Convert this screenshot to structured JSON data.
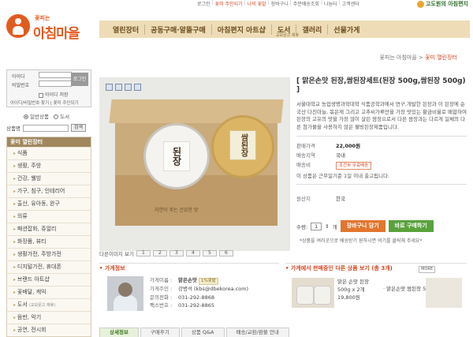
{
  "topbar": {
    "links": [
      "로그인",
      "꽃미 주인되기",
      "나의 꽃밭",
      "장바구니",
      "주문배송조회",
      "나눔터",
      "고객센터"
    ],
    "sponsor": "고도원의 아침편지"
  },
  "logo": {
    "small": "꽃피는",
    "big": "아침마을"
  },
  "nav": {
    "items": [
      {
        "label": "열린장터"
      },
      {
        "label": "공동구매·알뜰구매"
      },
      {
        "label": "아침편지 아트샵"
      },
      {
        "label": "도서",
        "sub": "교보문고 제휴"
      },
      {
        "label": "갤러리"
      },
      {
        "label": "선물가게"
      }
    ]
  },
  "breadcrumb": {
    "home": "꽃피는 아침마을",
    "sep": ">",
    "current": "꽃미 열린장터"
  },
  "login": {
    "id_label": "아이디",
    "pw_label": "비밀번호",
    "button": "로그인",
    "save_label": "아이디 저장",
    "links": "아이디/비밀번호 찾기 | 꽃미 주인되기"
  },
  "search": {
    "type_options": [
      "일반상품",
      "도서"
    ],
    "label": "상품명",
    "button": "검색"
  },
  "categories": {
    "title": "꽃미 열린장터",
    "items": [
      {
        "label": "식품"
      },
      {
        "label": "생활, 주방"
      },
      {
        "label": "건강, 웰빙"
      },
      {
        "label": "가구, 침구, 인테리어"
      },
      {
        "label": "출산, 유아동, 완구"
      },
      {
        "label": "의류"
      },
      {
        "label": "패션잡화, 쥬얼리"
      },
      {
        "label": "화장품, 뷰티"
      },
      {
        "label": "생활가전, 주방가전"
      },
      {
        "label": "디지털가전, 휴대폰"
      },
      {
        "label": "브랜드 아트샵"
      },
      {
        "label": "꽃배달, 케익"
      },
      {
        "label": "도서",
        "sub": "(교보문고 제휴)"
      },
      {
        "label": "음반, 악기"
      },
      {
        "label": "공연, 전시회"
      }
    ]
  },
  "product": {
    "jar_labels": [
      "된장",
      "쌈된장"
    ],
    "box_slogan": "자연이 주는 건강한 맛",
    "title": "[ 맑은손맛 된장,쌈된장세트(된장 500g,쌈된장 500g) ]",
    "description": "서울대학교 농업생명과학대학 식품공학과에서 연구,개발한 된장과 이 된장에 순국산 다진마늘, 볶은깨 그리고 고추씨가루만을 가장 맛있는 황금비율로 배합하여 된장의 고유의 맛을 가장 많이 살린 쌈장으로서 다른 쌈장과는 다르게 일체의 다른 첨가물을 사용하지 않은 웰빙된장제품입니다.",
    "price_label": "판매가격",
    "price": "22,000원",
    "region_label": "배송지역",
    "region": "국내",
    "shipping_label": "배송비",
    "shipping": "조건부 무료배송",
    "note": "이 상품은 근무일기준 1일 이내 출고됩니다.",
    "origin_label": "원산지",
    "origin": "한국",
    "qty_label": "수량:",
    "qty": "1",
    "qty_unit": "개",
    "cart_button": "장바구니 담기",
    "buy_button": "바로 구매하기",
    "buy_note": "*상품을 여러곳으로 배송받기 원하시면 여기를 클릭해 주세요*",
    "thumbs_label": "다른이미지 보기",
    "thumbs": [
      "1",
      "2",
      "3",
      "4",
      "5",
      "6"
    ]
  },
  "shop": {
    "title": "가게정보",
    "name_label": "가게이름 :",
    "name": "맑은손맛",
    "grade": "1%꽃밭",
    "owner_label": "가게주인 :",
    "owner": "강병석 (kbs@dbekorea.com)",
    "phone_label": "문의전화 :",
    "phone": "031-292-8868",
    "fax_label": "팩스번호 :",
    "fax": "031-292-8865"
  },
  "other": {
    "title": "가게에서 판매중인 다른 상품 보기",
    "count": "(총 3개)",
    "more": "MORE",
    "item1_name": "맑은 손맛 된장",
    "item1_size": "500g x 2개",
    "item1_price": "19,800원",
    "item2_name": "· 맑은손맛 쌈된장 50.."
  },
  "tabs": [
    "상세정보",
    "구매후기",
    "상품 Q&A",
    "배송/교환/환불 안내"
  ]
}
